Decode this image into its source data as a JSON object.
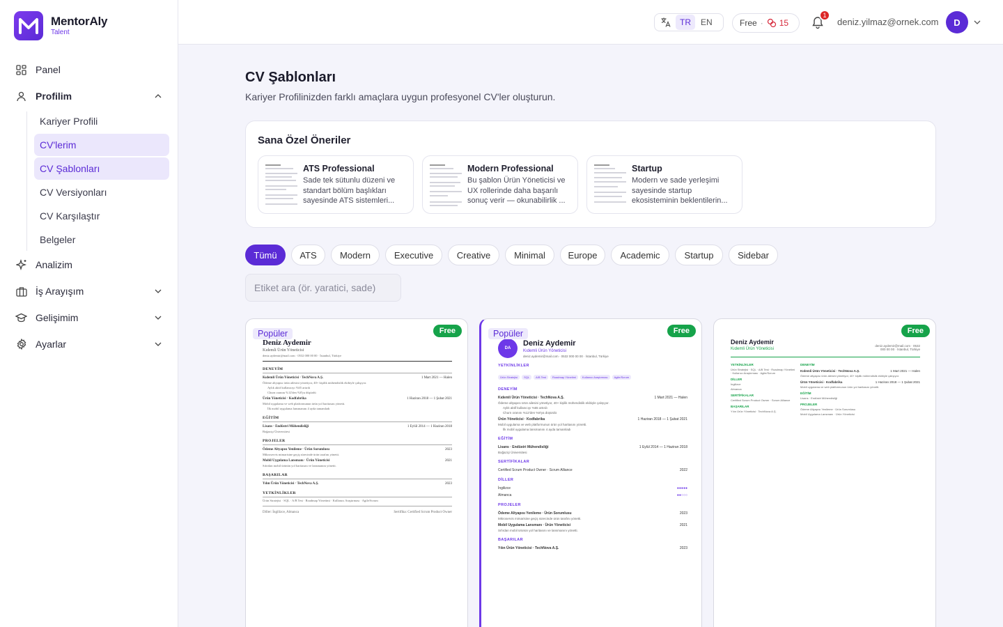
{
  "brand": {
    "name": "MentorAly",
    "sub": "Talent"
  },
  "sidebar": {
    "panel": "Panel",
    "profilim": "Profilim",
    "sub": [
      "Kariyer Profili",
      "CV'lerim",
      "CV Şablonları",
      "CV Versiyonları",
      "CV Karşılaştır",
      "Belgeler"
    ],
    "analizim": "Analizim",
    "is_arayisim": "İş Arayışım",
    "gelisimim": "Gelişimim",
    "ayarlar": "Ayarlar"
  },
  "topbar": {
    "lang_tr": "TR",
    "lang_en": "EN",
    "plan": "Free",
    "credits": "15",
    "notif_count": "1",
    "email": "deniz.yilmaz@ornek.com",
    "avatar": "D"
  },
  "page": {
    "title": "CV Şablonları",
    "subtitle": "Kariyer Profilinizden farklı amaçlara uygun profesyonel CV'ler oluşturun."
  },
  "recommendations": {
    "title": "Sana Özel Öneriler",
    "items": [
      {
        "name": "ATS Professional",
        "desc": "Sade tek sütunlu düzeni ve standart bölüm başlıkları sayesinde ATS sistemleri..."
      },
      {
        "name": "Modern Professional",
        "desc": "Bu şablon Ürün Yöneticisi ve UX rollerinde daha başarılı sonuç verir — okunabilirlik ..."
      },
      {
        "name": "Startup",
        "desc": "Modern ve sade yerleşimi sayesinde startup ekosisteminin beklentilerin..."
      }
    ]
  },
  "filters": [
    "Tümü",
    "ATS",
    "Modern",
    "Executive",
    "Creative",
    "Minimal",
    "Europe",
    "Academic",
    "Startup",
    "Sidebar"
  ],
  "search": {
    "placeholder": "Etiket ara (ör. yaratici, sade)"
  },
  "templates": {
    "popular": "Popüler",
    "free": "Free",
    "cv": {
      "name": "Deniz Aydemir",
      "title": "Kıdemli Ürün Yöneticisi",
      "contact": "deniz.aydemir@mail.com · 0532 000 00 00 · İstanbul, Türkiye",
      "sec_experience": "DENEYİM",
      "job1": "Kıdemli Ürün Yöneticisi · TechNova A.Ş.",
      "job1_date": "1 Mart 2021 — Halen",
      "job1_desc": "Ödeme altyapısı ürün ailesini yönetiyor, 40+ kişilik mühendislik ekibiyle çalışıyor.",
      "job1_b1": "Aylık aktif kullanıcıyı %65 artırdı",
      "job1_b2": "Churn oranını %12'den %8'ya düşürdü",
      "job2": "Ürün Yöneticisi · Kodfabrika",
      "job2_date": "1 Haziran 2018 — 1 Şubat 2021",
      "job2_desc": "Mobil uygulama ve web platformunun ürün yol haritasını yönetti.",
      "job2_b1": "İlk mobil uygulama lansmanını 4 ayda tamamladı",
      "sec_education": "EĞİTİM",
      "edu": "Lisans · Endüstri Mühendisliği",
      "edu_date": "1 Eylül 2014 — 1 Haziran 2018",
      "edu_school": "Boğaziçi Üniversitesi",
      "sec_projects": "PROJELER",
      "proj1": "Ödeme Altyapısı Yenileme · Ürün Sorumlusu",
      "proj1_year": "2023",
      "proj1_desc": "Mikroservis mimarisine geçiş sürecinde ürün tarafını yönetti.",
      "proj2": "Mobil Uygulama Lansmanı · Ürün Yöneticisi",
      "proj2_year": "2021",
      "proj2_desc": "Sıfırdan mobil ürünün yol haritasını ve lansmanını yönetti.",
      "sec_awards": "BAŞARILAR",
      "award": "Yılın Ürün Yöneticisi · TechNova A.Ş.",
      "award_year": "2023",
      "sec_skills": "YETKİNLİKLER",
      "skills": "Ürün Stratejisi · SQL · A/B Test · Roadmap Yönetimi · Kullanıcı Araştırması · Agile/Scrum",
      "footer_lang": "Diller: İngilizce, Almanca",
      "footer_cert": "Sertifika: Certified Scrum Product Owner",
      "sec_cert": "SERTİFİKALAR",
      "cert": "Certified Scrum Product Owner · Scrum Alliance",
      "cert_year": "2022",
      "sec_lang": "DİLLER",
      "lang1": "İngilizce",
      "lang2": "Almanca",
      "avatar": "DA",
      "tags": [
        "Ürün Stratejisi",
        "SQL",
        "A/B Test",
        "Roadmap Yönetimi",
        "Kullanıcı Araştırması",
        "Agile/Scrum"
      ]
    }
  },
  "colors": {
    "primary": "#5b2bd6",
    "free": "#16a34a",
    "danger": "#dc2626"
  }
}
